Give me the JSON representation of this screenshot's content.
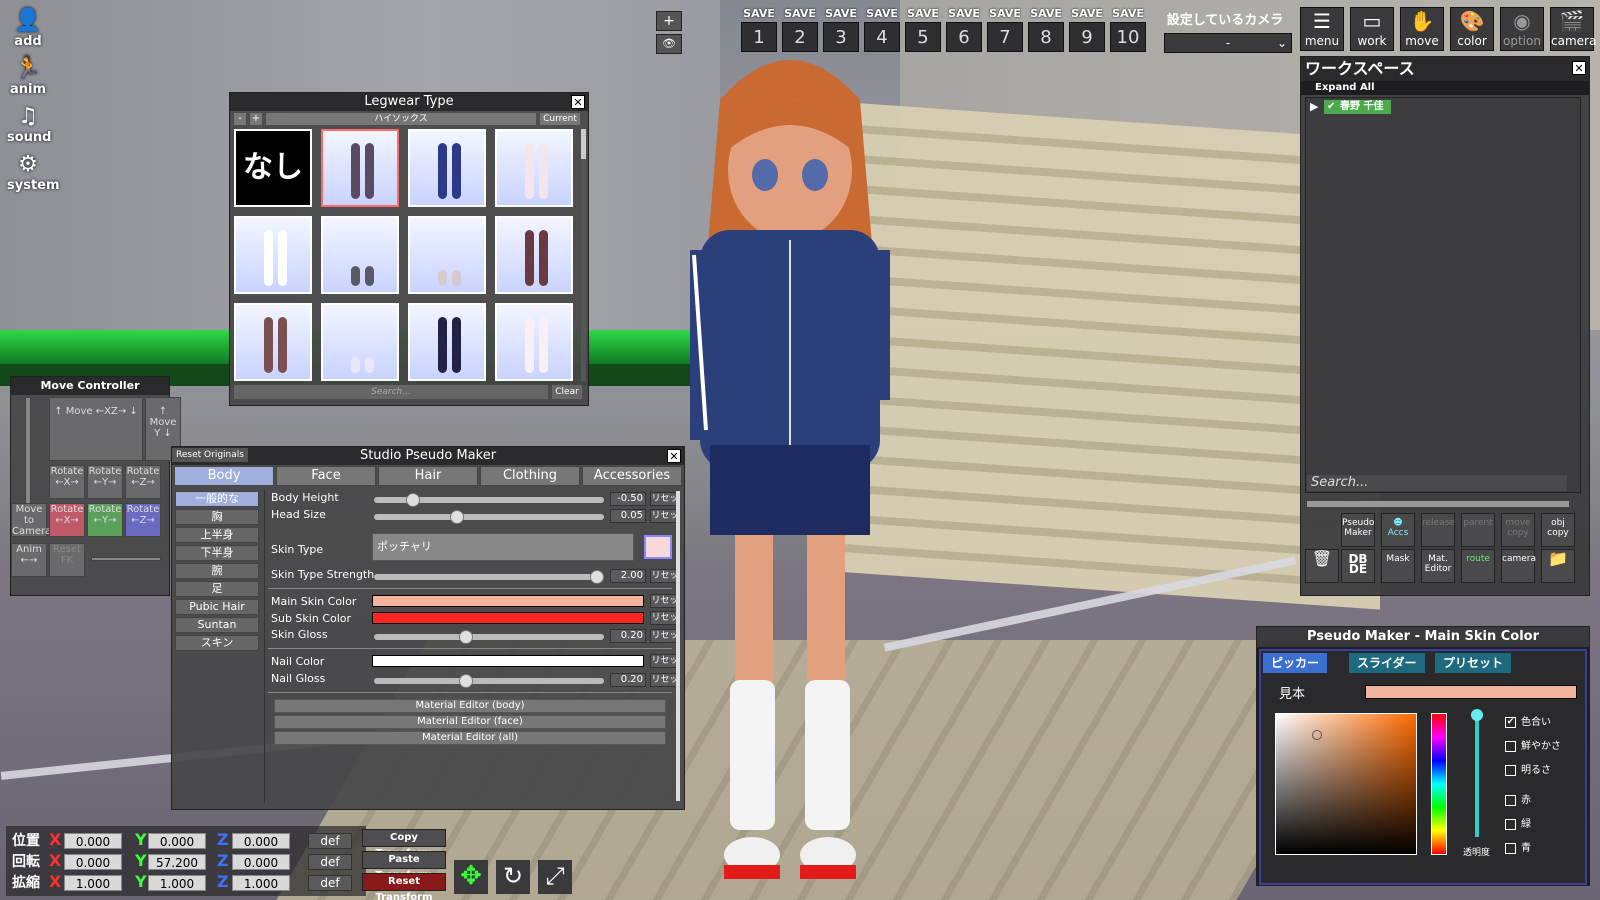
{
  "left_menu": [
    {
      "label": "add",
      "icon": "person-add-icon"
    },
    {
      "label": "anim",
      "icon": "running-figure-icon"
    },
    {
      "label": "sound",
      "icon": "music-note-icon"
    },
    {
      "label": "system",
      "icon": "gears-icon"
    }
  ],
  "view_controls": {
    "plus": "+",
    "eye": "👁"
  },
  "save_slots": {
    "label": "SAVE",
    "numbers": [
      "1",
      "2",
      "3",
      "4",
      "5",
      "6",
      "7",
      "8",
      "9",
      "10"
    ]
  },
  "camera_setting": {
    "label": "設定しているカメラ",
    "value": "-"
  },
  "top_buttons": [
    "menu",
    "work",
    "move",
    "color",
    "option",
    "camera"
  ],
  "workspace": {
    "title": "ワークスペース",
    "expand_all": "Expand All",
    "tree_item": "春野 千佳",
    "search_placeholder": "Search...",
    "buttons_row1": [
      "Pseudo Maker",
      "Accs",
      "release",
      "parent",
      "move copy",
      "obj copy"
    ],
    "buttons_row2": [
      "trash",
      "DB DE",
      "Mask",
      "Mat. Editor",
      "route",
      "camera",
      "folder"
    ]
  },
  "legwear": {
    "title": "Legwear Type",
    "minus": "-",
    "plus": "+",
    "current_name": "ハイソックス",
    "current_btn": "Current",
    "none_label": "なし",
    "search_placeholder": "Search...",
    "clear": "Clear"
  },
  "move_controller": {
    "title": "Move Controller",
    "move_xz": "↑ Move ←XZ→ ↓",
    "move_y": "↑ Move Y ↓",
    "rot1": [
      "Rotate ←X→",
      "Rotate ←Y→",
      "Rotate ←Z→"
    ],
    "move_to_camera": "Move to Camera",
    "rot2": [
      "Rotate ←X→",
      "Rotate ←Y→",
      "Rotate ←Z→"
    ],
    "anim": "Anim ←→",
    "reset_fk": "Reset FK"
  },
  "pseudo_maker": {
    "title": "Studio Pseudo Maker",
    "reset_originals": "Reset Originals",
    "tabs": [
      "Body",
      "Face",
      "Hair",
      "Clothing",
      "Accessories"
    ],
    "side": [
      "一般的な",
      "胸",
      "上半身",
      "下半身",
      "腕",
      "足",
      "Pubic Hair",
      "Suntan",
      "スキン"
    ],
    "body_height": {
      "label": "Body Height",
      "value": "-0.50",
      "fraction": 0.17
    },
    "head_size": {
      "label": "Head Size",
      "value": "0.05",
      "fraction": 0.36
    },
    "skin_type": {
      "label": "Skin Type",
      "value": "ポッチャリ"
    },
    "skin_type_strength": {
      "label": "Skin Type Strength",
      "value": "2.00",
      "fraction": 0.97
    },
    "main_skin_color": {
      "label": "Main Skin Color",
      "color": "#f3b39c"
    },
    "sub_skin_color": {
      "label": "Sub Skin Color",
      "color": "#ff2525"
    },
    "skin_gloss": {
      "label": "Skin Gloss",
      "value": "0.20",
      "fraction": 0.4
    },
    "nail_color": {
      "label": "Nail Color",
      "color": "#ffffff"
    },
    "nail_gloss": {
      "label": "Nail Gloss",
      "value": "0.20",
      "fraction": 0.4
    },
    "reset_label": "リセッ",
    "mat_buttons": [
      "Material Editor (body)",
      "Material Editor (face)",
      "Material Editor (all)"
    ]
  },
  "transform": {
    "rows": [
      {
        "label": "位置",
        "x": "0.000",
        "y": "0.000",
        "z": "0.000"
      },
      {
        "label": "回転",
        "x": "0.000",
        "y": "57.200",
        "z": "0.000"
      },
      {
        "label": "拡縮",
        "x": "1.000",
        "y": "1.000",
        "z": "1.000"
      }
    ],
    "axes": [
      "X",
      "Y",
      "Z"
    ],
    "def": "def",
    "actions": [
      "Copy Transform",
      "Paste Transform",
      "Reset Transform"
    ]
  },
  "color_picker": {
    "title": "Pseudo Maker - Main Skin Color",
    "tabs": [
      "ピッカー",
      "スライダー",
      "プリセット"
    ],
    "sample_label": "見本",
    "sample_color": "#f3b39c",
    "checks": [
      "色合い",
      "鮮やかさ",
      "明るさ",
      "赤",
      "緑",
      "青"
    ],
    "alpha_label": "透明度"
  }
}
